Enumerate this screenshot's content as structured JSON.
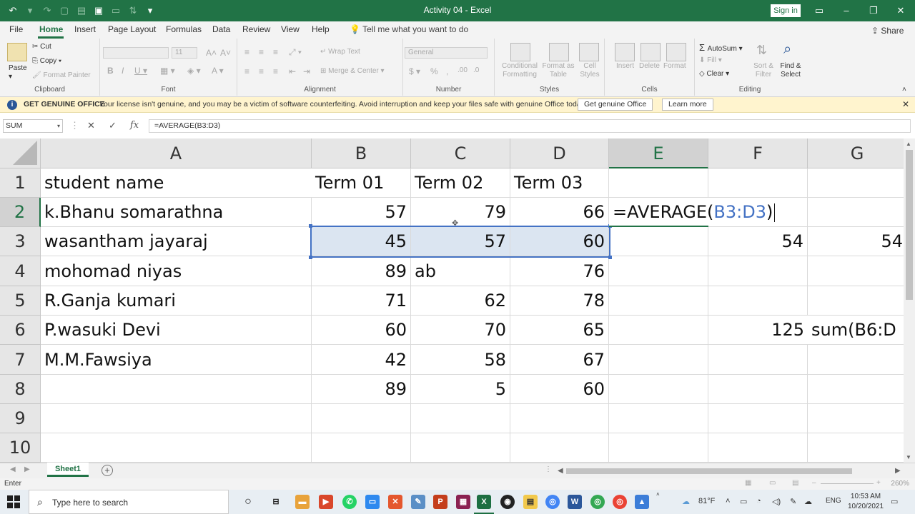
{
  "window": {
    "title": "Activity 04  -  Excel",
    "sign_in": "Sign in",
    "share": "Share"
  },
  "colors": {
    "accent": "#217346",
    "range_blue": "#4472c4",
    "range_fill": "#dbe5f1"
  },
  "tabs": [
    "File",
    "Home",
    "Insert",
    "Page Layout",
    "Formulas",
    "Data",
    "Review",
    "View",
    "Help"
  ],
  "active_tab": "Home",
  "tell_me": "Tell me what you want to do",
  "ribbon": {
    "clipboard": {
      "label": "Clipboard",
      "paste": "Paste",
      "cut": "Cut",
      "copy": "Copy",
      "format_painter": "Format Painter"
    },
    "font": {
      "label": "Font",
      "size": "11"
    },
    "alignment": {
      "label": "Alignment",
      "wrap_text": "Wrap Text",
      "merge_center": "Merge & Center"
    },
    "number": {
      "label": "Number",
      "format": "General"
    },
    "styles": {
      "label": "Styles",
      "conditional": "Conditional Formatting",
      "format_table": "Format as Table",
      "cell_styles": "Cell Styles"
    },
    "cells": {
      "label": "Cells",
      "insert": "Insert",
      "delete": "Delete",
      "format": "Format"
    },
    "editing": {
      "label": "Editing",
      "autosum": "AutoSum",
      "fill": "Fill",
      "clear": "Clear",
      "sort_filter": "Sort & Filter",
      "find_select": "Find & Select"
    }
  },
  "infobar": {
    "title": "GET GENUINE OFFICE",
    "message": "Your license isn't genuine, and you may be a victim of software counterfeiting. Avoid interruption and keep your files safe with genuine Office today.",
    "get_button": "Get genuine Office",
    "learn_button": "Learn more"
  },
  "formula_bar": {
    "name_box": "SUM",
    "formula": "=AVERAGE(B3:D3)"
  },
  "sheet": {
    "columns": [
      "A",
      "B",
      "C",
      "D",
      "E",
      "F",
      "G"
    ],
    "selected_column": "E",
    "rows": [
      "1",
      "2",
      "3",
      "4",
      "5",
      "6",
      "7",
      "8",
      "9",
      "10"
    ],
    "selected_row": "2",
    "cells": {
      "A1": "student name",
      "B1": "Term 01",
      "C1": "Term 02",
      "D1": "Term 03",
      "A2": "k.Bhanu somarathna",
      "B2": "57",
      "C2": "79",
      "D2": "66",
      "A3": "wasantham jayaraj",
      "B3": "45",
      "C3": "57",
      "D3": "60",
      "F3": "54",
      "G3": "54",
      "A4": "mohomad niyas",
      "B4": "89",
      "C4": "ab",
      "D4": "76",
      "A5": "R.Ganja kumari",
      "B5": "71",
      "C5": "62",
      "D5": "78",
      "A6": "P.wasuki Devi",
      "B6": "60",
      "C6": "70",
      "D6": "65",
      "F6": "125",
      "G6": "sum(B6:D",
      "A7": "M.M.Fawsiya",
      "B7": "42",
      "C7": "58",
      "D7": "67",
      "B8": "89",
      "C8": "5",
      "D8": "60"
    },
    "edit_cell": {
      "prefix": "=AVERAGE(",
      "ref": "B3:D3",
      "suffix": ")"
    },
    "sheet_tab": "Sheet1"
  },
  "status": {
    "mode": "Enter",
    "zoom": "260%"
  },
  "taskbar": {
    "search_placeholder": "Type here to search",
    "weather": "81°F",
    "lang": "ENG",
    "time": "10:53 AM",
    "date": "10/20/2021"
  }
}
